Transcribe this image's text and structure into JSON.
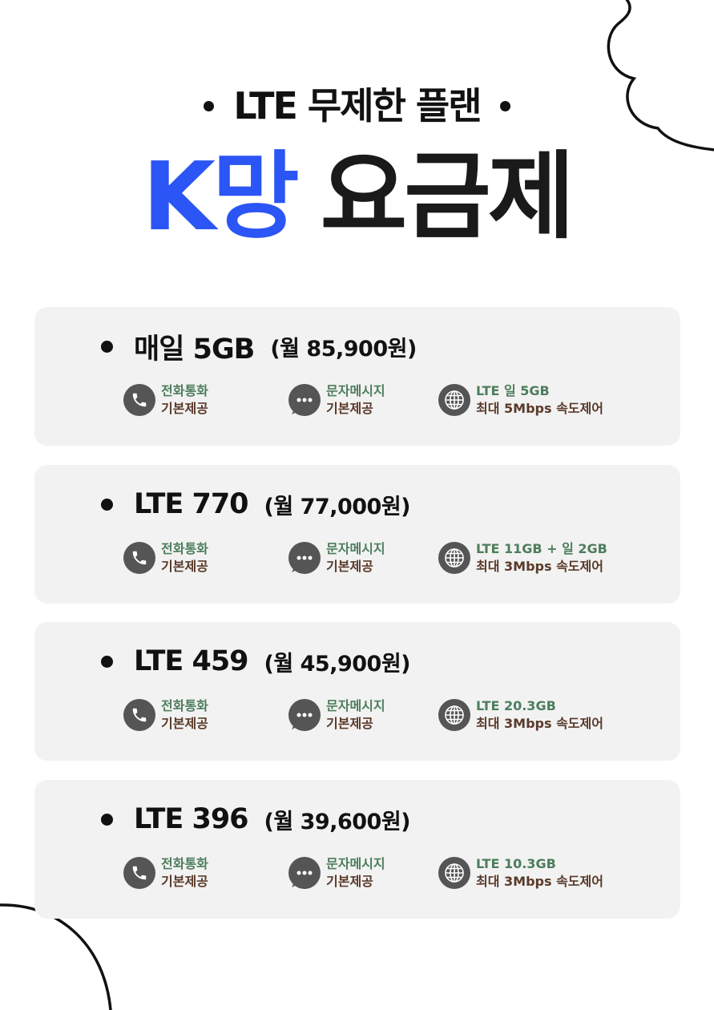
{
  "subtitle": "LTE 무제한 플랜",
  "title": {
    "accent": "K망",
    "main": "요금제"
  },
  "colors": {
    "accent": "#2b55f5",
    "card_bg": "#f2f2f2",
    "feature_primary": "#4d7d5c",
    "feature_secondary": "#5a3a2a",
    "icon_bg": "#555555"
  },
  "plans": [
    {
      "name": "매일 5GB",
      "price": "(월 85,900원)",
      "call": {
        "line1": "전화통화",
        "line2": "기본제공",
        "icon": "phone-icon"
      },
      "sms": {
        "line1": "문자메시지",
        "line2": "기본제공",
        "icon": "chat-bubble-icon"
      },
      "data": {
        "line1": "LTE 일 5GB",
        "line2": "최대 5Mbps 속도제어",
        "icon": "globe-icon"
      }
    },
    {
      "name": "LTE 770",
      "price": "(월 77,000원)",
      "call": {
        "line1": "전화통화",
        "line2": "기본제공",
        "icon": "phone-icon"
      },
      "sms": {
        "line1": "문자메시지",
        "line2": "기본제공",
        "icon": "chat-bubble-icon"
      },
      "data": {
        "line1": "LTE 11GB + 일 2GB",
        "line2": "최대 3Mbps 속도제어",
        "icon": "globe-icon"
      }
    },
    {
      "name": "LTE 459",
      "price": "(월 45,900원)",
      "call": {
        "line1": "전화통화",
        "line2": "기본제공",
        "icon": "phone-icon"
      },
      "sms": {
        "line1": "문자메시지",
        "line2": "기본제공",
        "icon": "chat-bubble-icon"
      },
      "data": {
        "line1": "LTE 20.3GB",
        "line2": "최대 3Mbps 속도제어",
        "icon": "globe-icon"
      }
    },
    {
      "name": "LTE 396",
      "price": "(월 39,600원)",
      "call": {
        "line1": "전화통화",
        "line2": "기본제공",
        "icon": "phone-icon"
      },
      "sms": {
        "line1": "문자메시지",
        "line2": "기본제공",
        "icon": "chat-bubble-icon"
      },
      "data": {
        "line1": "LTE 10.3GB",
        "line2": "최대 3Mbps 속도제어",
        "icon": "globe-icon"
      }
    }
  ]
}
